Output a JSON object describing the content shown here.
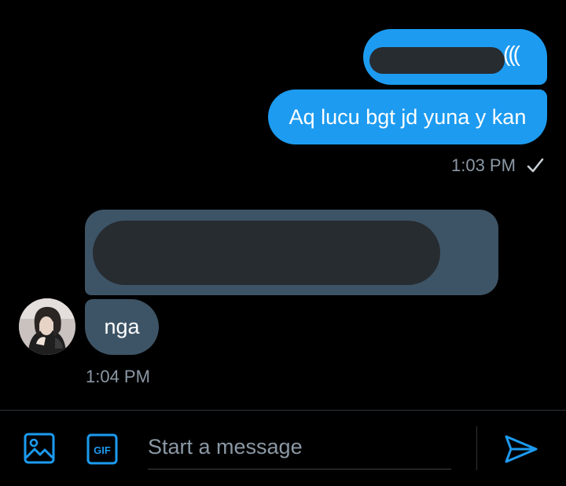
{
  "conversation": {
    "outgoing": [
      {
        "visible_text": "((("
      },
      {
        "text": "Aq lucu bgt jd yuna y kan"
      }
    ],
    "outgoing_time": "1:03 PM",
    "incoming": [
      {
        "text": "nga"
      }
    ],
    "incoming_time": "1:04 PM"
  },
  "composer": {
    "placeholder": "Start a message",
    "media_icon": "image-icon",
    "gif_icon": "gif-icon",
    "gif_label": "GIF",
    "send_icon": "send-icon"
  },
  "colors": {
    "background": "#000000",
    "accent": "#1d9bf0",
    "incoming_bubble": "#3d5466",
    "timestamp": "#8b98a5",
    "redaction": "#272c31"
  }
}
